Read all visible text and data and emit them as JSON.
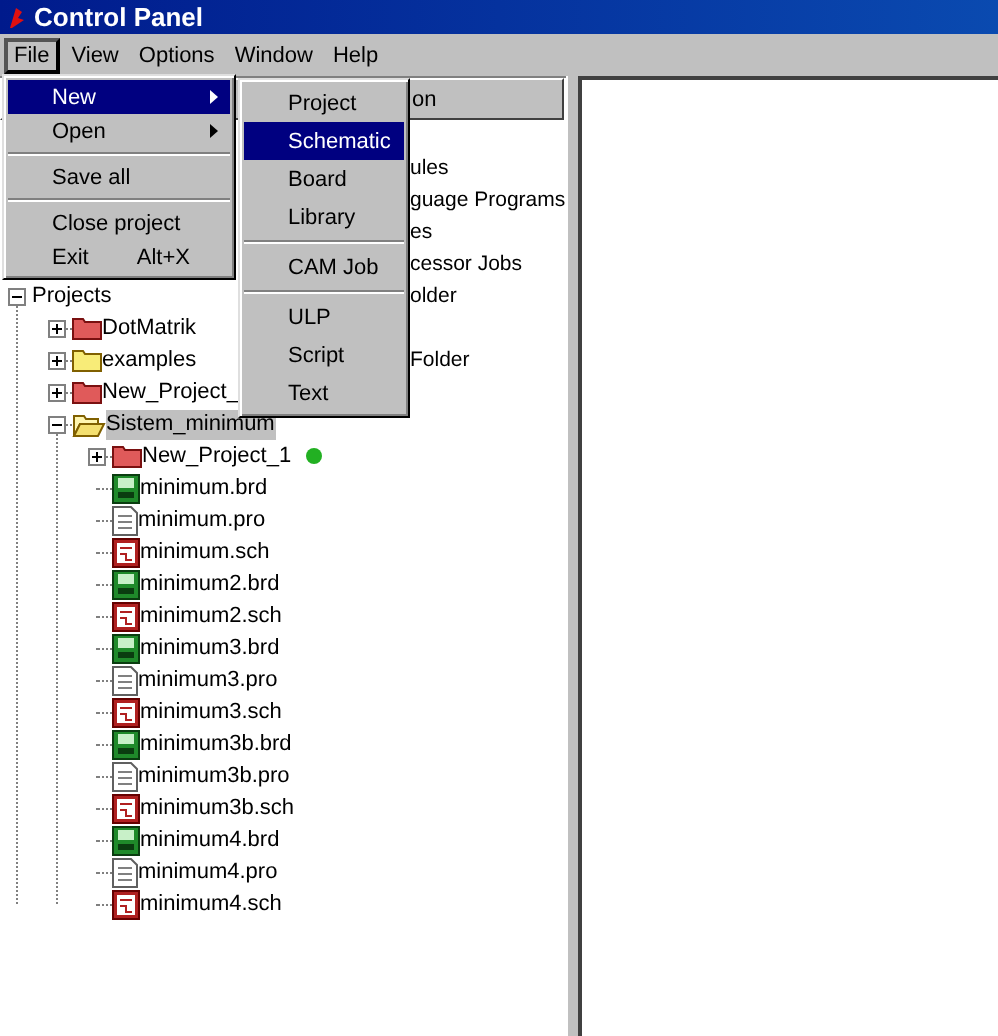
{
  "window": {
    "title": "Control Panel"
  },
  "menu_bar": [
    {
      "label": "File",
      "selected": true
    },
    {
      "label": "View",
      "selected": false
    },
    {
      "label": "Options",
      "selected": false
    },
    {
      "label": "Window",
      "selected": false
    },
    {
      "label": "Help",
      "selected": false
    }
  ],
  "file_menu": [
    {
      "kind": "item",
      "label": "New",
      "submenu": true,
      "selected": true
    },
    {
      "kind": "item",
      "label": "Open",
      "submenu": true,
      "selected": false
    },
    {
      "kind": "separator"
    },
    {
      "kind": "item",
      "label": "Save all",
      "submenu": false,
      "selected": false
    },
    {
      "kind": "separator"
    },
    {
      "kind": "item",
      "label": "Close project",
      "submenu": false,
      "selected": false
    },
    {
      "kind": "item",
      "label": "Exit",
      "shortcut": "Alt+X",
      "submenu": false,
      "selected": false
    }
  ],
  "new_submenu": [
    {
      "kind": "item",
      "label": "Project",
      "selected": false
    },
    {
      "kind": "item",
      "label": "Schematic",
      "selected": true
    },
    {
      "kind": "item",
      "label": "Board",
      "selected": false
    },
    {
      "kind": "item",
      "label": "Library",
      "selected": false
    },
    {
      "kind": "separator"
    },
    {
      "kind": "item",
      "label": "CAM Job",
      "selected": false
    },
    {
      "kind": "separator"
    },
    {
      "kind": "item",
      "label": "ULP",
      "selected": false
    },
    {
      "kind": "item",
      "label": "Script",
      "selected": false
    },
    {
      "kind": "item",
      "label": "Text",
      "selected": false
    }
  ],
  "tree_panel": {
    "column_header": "on",
    "covered_rows": [
      "ules",
      "guage Programs",
      "es",
      "cessor Jobs"
    ],
    "tree": [
      {
        "kind": "root",
        "label": "Projects",
        "tail": "older",
        "expanded": true,
        "selected": false,
        "children": [
          {
            "kind": "project",
            "label": "DotMatrik",
            "expanded": false,
            "selected": false
          },
          {
            "kind": "folder",
            "label": "examples",
            "tail": "Folder",
            "expanded": false,
            "selected": false
          },
          {
            "kind": "project",
            "label": "New_Project_",
            "expanded": false,
            "selected": false
          },
          {
            "kind": "folder",
            "label": "Sistem_minimum",
            "expanded": true,
            "selected": true,
            "children": [
              {
                "kind": "project",
                "label": "New_Project_1",
                "expanded": false,
                "selected": false,
                "color": "#22b022"
              },
              {
                "kind": "brd",
                "label": "minimum.brd",
                "selected": false
              },
              {
                "kind": "pro",
                "label": "minimum.pro",
                "selected": false
              },
              {
                "kind": "sch",
                "label": "minimum.sch",
                "selected": false
              },
              {
                "kind": "brd",
                "label": "minimum2.brd",
                "selected": false
              },
              {
                "kind": "sch",
                "label": "minimum2.sch",
                "selected": false
              },
              {
                "kind": "brd",
                "label": "minimum3.brd",
                "selected": false
              },
              {
                "kind": "pro",
                "label": "minimum3.pro",
                "selected": false
              },
              {
                "kind": "sch",
                "label": "minimum3.sch",
                "selected": false
              },
              {
                "kind": "brd",
                "label": "minimum3b.brd",
                "selected": false
              },
              {
                "kind": "pro",
                "label": "minimum3b.pro",
                "selected": false
              },
              {
                "kind": "sch",
                "label": "minimum3b.sch",
                "selected": false
              },
              {
                "kind": "brd",
                "label": "minimum4.brd",
                "selected": false
              },
              {
                "kind": "pro",
                "label": "minimum4.pro",
                "selected": false
              },
              {
                "kind": "sch",
                "label": "minimum4.sch",
                "selected": false
              }
            ]
          }
        ]
      }
    ]
  }
}
